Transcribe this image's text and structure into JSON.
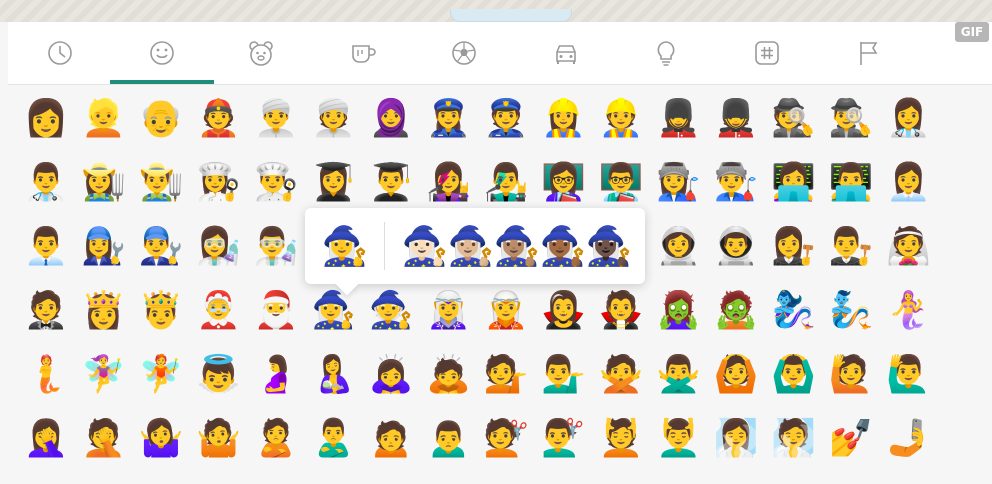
{
  "category_bar": {
    "tabs": [
      {
        "id": "recent",
        "icon": "clock-icon"
      },
      {
        "id": "smileys",
        "icon": "smiley-icon",
        "active": true
      },
      {
        "id": "animals",
        "icon": "bear-icon"
      },
      {
        "id": "food",
        "icon": "cup-icon"
      },
      {
        "id": "activity",
        "icon": "soccer-ball-icon"
      },
      {
        "id": "travel",
        "icon": "car-icon"
      },
      {
        "id": "objects",
        "icon": "lightbulb-icon"
      },
      {
        "id": "symbols",
        "icon": "hash-icon"
      },
      {
        "id": "flags",
        "icon": "flag-icon"
      }
    ],
    "gif_label": "GIF",
    "accent_color": "#1f8c7c"
  },
  "emoji_grid": {
    "rows": [
      [
        "👩",
        "👱",
        "👴",
        "👲",
        "👳‍♂️",
        "👳",
        "🧕",
        "👮‍♀️",
        "👮",
        "👷‍♀️",
        "👷",
        "💂‍♀️",
        "💂",
        "🕵️",
        "🕵️‍♂️",
        "👩‍⚕️"
      ],
      [
        "👨‍⚕️",
        "👩‍🌾",
        "👨‍🌾",
        "👩‍🍳",
        "👨‍🍳",
        "👩‍🎓",
        "👨‍🎓",
        "👩‍🎤",
        "👨‍🎤",
        "👩‍🏫",
        "👨‍🏫",
        "👩‍🏭",
        "👨‍🏭",
        "👩‍💻",
        "👨‍💻",
        "👩‍💼"
      ],
      [
        "👨‍💼",
        "👩‍🔧",
        "👨‍🔧",
        "👩‍🔬",
        "👨‍🔬",
        "👩‍🎨",
        "👨‍🎨",
        "👩‍🚒",
        "👨‍🚒",
        "👩‍✈️",
        "👨‍✈️",
        "👩‍🚀",
        "👨‍🚀",
        "👩‍⚖️",
        "👨‍⚖️",
        "👰"
      ],
      [
        "🤵",
        "👸",
        "🤴",
        "🤶",
        "🎅",
        "🧙‍♀️",
        "🧙",
        "🧝‍♀️",
        "🧝",
        "🧛‍♀️",
        "🧛",
        "🧟‍♀️",
        "🧟",
        "🧞‍♀️",
        "🧞",
        "🧜‍♀️"
      ],
      [
        "🧜",
        "🧚‍♀️",
        "🧚",
        "👼",
        "🤰",
        "🤱",
        "🙇‍♀️",
        "🙇",
        "💁",
        "💁‍♂️",
        "🙅",
        "🙅‍♂️",
        "🙆",
        "🙆‍♂️",
        "🙋",
        "🙋‍♂️"
      ],
      [
        "🤦‍♀️",
        "🤦",
        "🤷‍♀️",
        "🤷",
        "🙎",
        "🙎‍♂️",
        "🙍",
        "🙍‍♂️",
        "💇",
        "💇‍♂️",
        "💆",
        "💆‍♂️",
        "🧖‍♀️",
        "🧖",
        "💅",
        "🤳"
      ]
    ]
  },
  "skin_tone_popup": {
    "base": "🧙‍♀️",
    "variants": [
      "🧙🏻‍♀️",
      "🧙🏼‍♀️",
      "🧙🏽‍♀️",
      "🧙🏾‍♀️",
      "🧙🏿‍♀️"
    ],
    "tones": [
      "#ffd23f",
      "#f6d5bd",
      "#e3b98f",
      "#c08c5d",
      "#8d5a34",
      "#5a3a22"
    ]
  }
}
